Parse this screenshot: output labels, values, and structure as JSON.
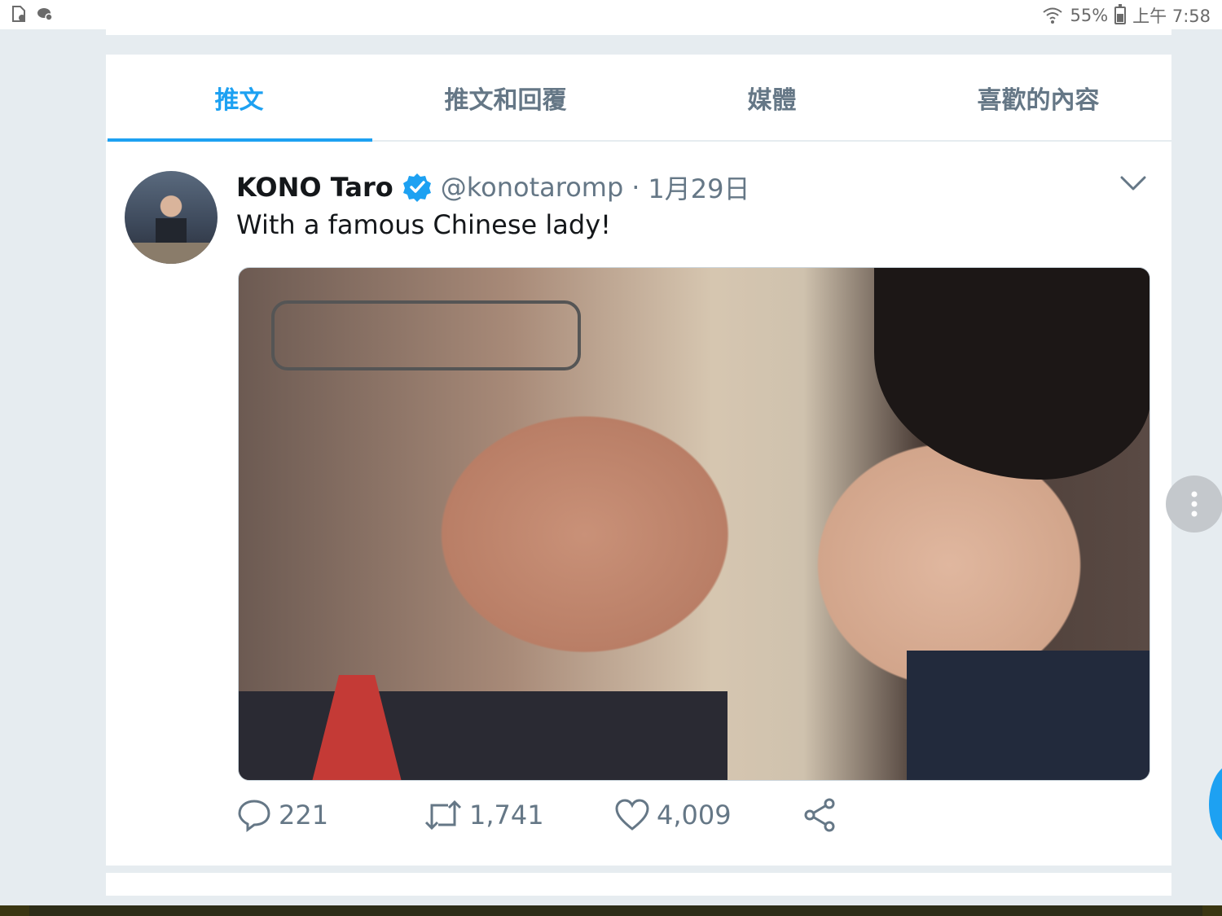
{
  "status_bar": {
    "battery": "55%",
    "time": "上午 7:58"
  },
  "tabs": [
    {
      "label": "推文",
      "active": true
    },
    {
      "label": "推文和回覆",
      "active": false
    },
    {
      "label": "媒體",
      "active": false
    },
    {
      "label": "喜歡的內容",
      "active": false
    }
  ],
  "tweet": {
    "author_name": "KONO Taro",
    "handle": "@konotaromp",
    "separator": "·",
    "date": "1月29日",
    "text": "With a famous Chinese lady!",
    "replies": "221",
    "retweets": "1,741",
    "likes": "4,009"
  },
  "colors": {
    "accent": "#1da1f2",
    "muted": "#657786",
    "background": "#e6ecf0"
  }
}
